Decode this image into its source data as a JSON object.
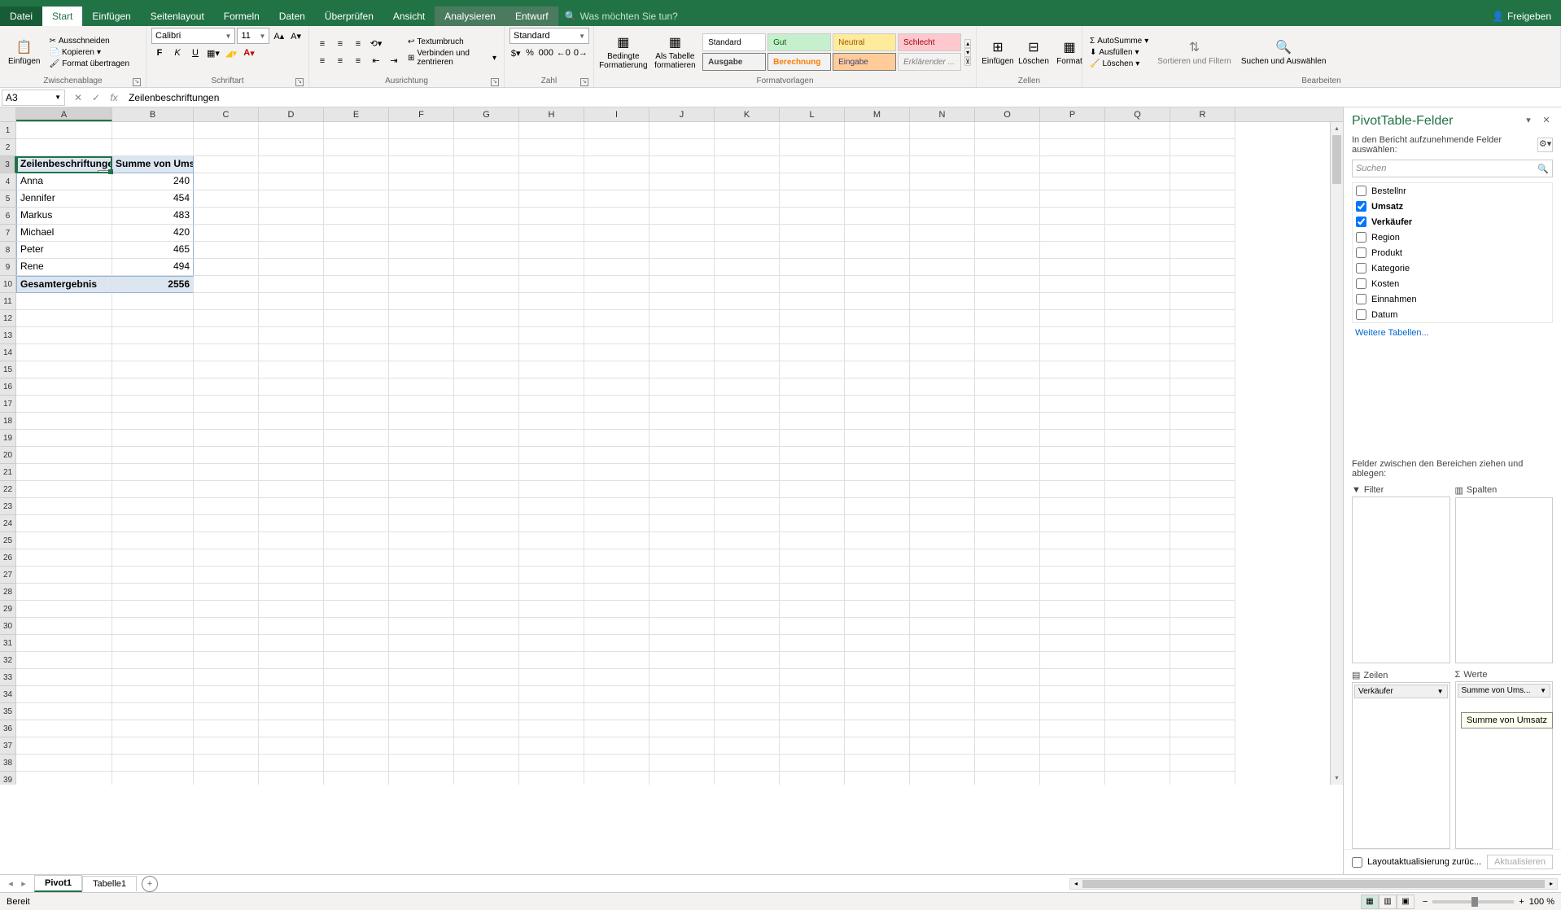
{
  "tabs": {
    "file": "Datei",
    "start": "Start",
    "einfugen": "Einfügen",
    "seitenlayout": "Seitenlayout",
    "formeln": "Formeln",
    "daten": "Daten",
    "uberprufen": "Überprüfen",
    "ansicht": "Ansicht",
    "analysieren": "Analysieren",
    "entwurf": "Entwurf",
    "tellme_placeholder": "Was möchten Sie tun?",
    "share": "Freigeben"
  },
  "ribbon": {
    "paste": "Einfügen",
    "cut": "Ausschneiden",
    "copy": "Kopieren",
    "format_painter": "Format übertragen",
    "clipboard": "Zwischenablage",
    "font_name": "Calibri",
    "font_size": "11",
    "font_group": "Schriftart",
    "wrap": "Textumbruch",
    "merge": "Verbinden und zentrieren",
    "alignment": "Ausrichtung",
    "number_format": "Standard",
    "number_group": "Zahl",
    "cond_format": "Bedingte Formatierung",
    "as_table": "Als Tabelle formatieren",
    "style_standard": "Standard",
    "style_gut": "Gut",
    "style_neutral": "Neutral",
    "style_schlecht": "Schlecht",
    "style_ausgabe": "Ausgabe",
    "style_berechnung": "Berechnung",
    "style_eingabe": "Eingabe",
    "style_erklar": "Erklärender ...",
    "styles_group": "Formatvorlagen",
    "insert": "Einfügen",
    "delete": "Löschen",
    "format": "Format",
    "cells_group": "Zellen",
    "autosum": "AutoSumme",
    "fill": "Ausfüllen",
    "clear": "Löschen",
    "sort_filter": "Sortieren und Filtern",
    "find_select": "Suchen und Auswählen",
    "editing_group": "Bearbeiten"
  },
  "formula_bar": {
    "name_box": "A3",
    "formula": "Zeilenbeschriftungen"
  },
  "columns": [
    "A",
    "B",
    "C",
    "D",
    "E",
    "F",
    "G",
    "H",
    "I",
    "J",
    "K",
    "L",
    "M",
    "N",
    "O",
    "P",
    "Q",
    "R"
  ],
  "pivot_table": {
    "row_label_header": "Zeilenbeschriftungen",
    "value_header": "Summe von Umsatz",
    "rows": [
      {
        "label": "Anna",
        "value": "240"
      },
      {
        "label": "Jennifer",
        "value": "454"
      },
      {
        "label": "Markus",
        "value": "483"
      },
      {
        "label": "Michael",
        "value": "420"
      },
      {
        "label": "Peter",
        "value": "465"
      },
      {
        "label": "Rene",
        "value": "494"
      }
    ],
    "total_label": "Gesamtergebnis",
    "total_value": "2556"
  },
  "pivot_pane": {
    "title": "PivotTable-Felder",
    "instruction": "In den Bericht aufzunehmende Felder auswählen:",
    "search_placeholder": "Suchen",
    "fields": [
      {
        "name": "Bestellnr",
        "checked": false
      },
      {
        "name": "Umsatz",
        "checked": true
      },
      {
        "name": "Verkäufer",
        "checked": true
      },
      {
        "name": "Region",
        "checked": false
      },
      {
        "name": "Produkt",
        "checked": false
      },
      {
        "name": "Kategorie",
        "checked": false
      },
      {
        "name": "Kosten",
        "checked": false
      },
      {
        "name": "Einnahmen",
        "checked": false
      },
      {
        "name": "Datum",
        "checked": false
      }
    ],
    "more_tables": "Weitere Tabellen...",
    "areas_label": "Felder zwischen den Bereichen ziehen und ablegen:",
    "filter": "Filter",
    "columns": "Spalten",
    "rows_area": "Zeilen",
    "values": "Werte",
    "row_item": "Verkäufer",
    "value_item": "Summe von Ums...",
    "value_tooltip": "Summe von Umsatz",
    "defer": "Layoutaktualisierung zurüc...",
    "update": "Aktualisieren"
  },
  "sheets": {
    "pivot": "Pivot1",
    "tabelle": "Tabelle1"
  },
  "status": {
    "ready": "Bereit",
    "zoom": "100 %"
  }
}
